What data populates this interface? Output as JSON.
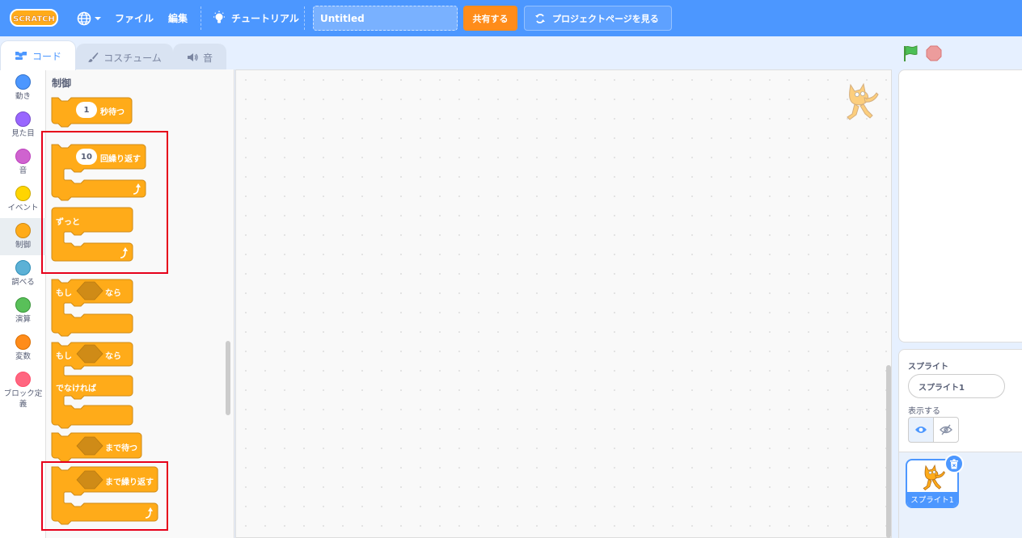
{
  "menubar": {
    "logo_text": "SCRATCH",
    "file_label": "ファイル",
    "edit_label": "編集",
    "tutorials_label": "チュートリアル",
    "project_title": "Untitled",
    "share_label": "共有する",
    "project_page_label": "プロジェクトページを見る"
  },
  "tabs": {
    "code": "コード",
    "costumes": "コスチューム",
    "sounds": "音"
  },
  "categories": [
    {
      "label": "動き",
      "color": "#4c97ff"
    },
    {
      "label": "見た目",
      "color": "#9966ff"
    },
    {
      "label": "音",
      "color": "#cf63cf"
    },
    {
      "label": "イベント",
      "color": "#ffd500"
    },
    {
      "label": "制御",
      "color": "#ffab19"
    },
    {
      "label": "調べる",
      "color": "#5cb1d6"
    },
    {
      "label": "演算",
      "color": "#59c059"
    },
    {
      "label": "変数",
      "color": "#ff8c1a"
    },
    {
      "label": "ブロック定義",
      "color": "#ff6680"
    }
  ],
  "palette": {
    "heading": "制御",
    "blocks": {
      "wait": {
        "value": "1",
        "label": "秒待つ"
      },
      "repeat": {
        "value": "10",
        "label": "回繰り返す"
      },
      "forever": {
        "label": "ずっと"
      },
      "if_then": {
        "label_if": "もし",
        "label_then": "なら"
      },
      "if_else": {
        "label_if": "もし",
        "label_then": "なら",
        "label_else": "でなければ"
      },
      "wait_until": {
        "label": "まで待つ"
      },
      "repeat_until": {
        "label": "まで繰り返す"
      }
    }
  },
  "sprite_info": {
    "sprite_label": "スプライト",
    "sprite_name": "スプライト1",
    "show_label": "表示する"
  },
  "sprite_list": [
    {
      "name": "スプライト1"
    }
  ],
  "colors": {
    "menubar": "#4c97ff",
    "control_block": "#ffab19",
    "control_border": "#cf8b17",
    "share_button": "#ff8c1a",
    "highlight": "#e6001a"
  }
}
